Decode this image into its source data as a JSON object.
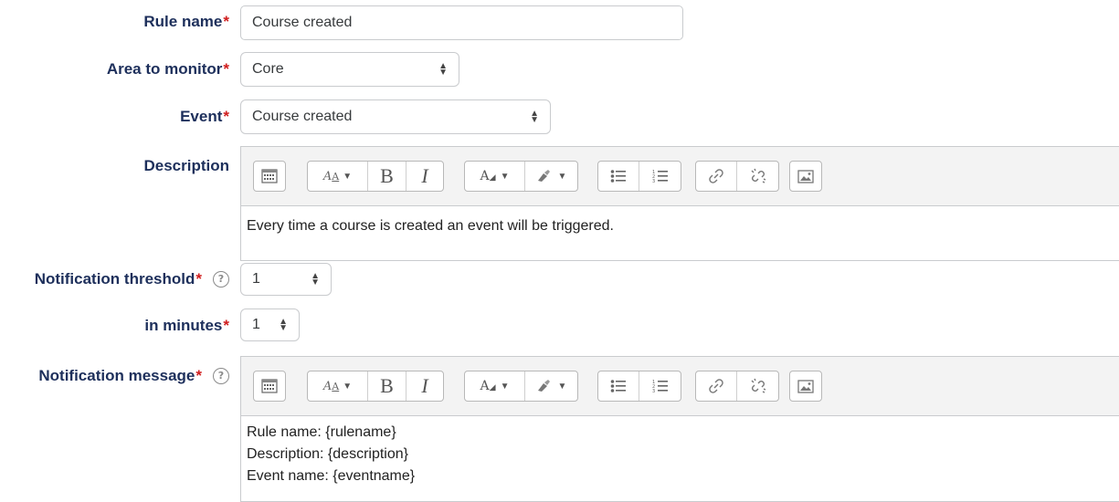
{
  "form": {
    "rule_name": {
      "label": "Rule name",
      "value": "Course created"
    },
    "area": {
      "label": "Area to monitor",
      "value": "Core"
    },
    "event": {
      "label": "Event",
      "value": "Course created"
    },
    "description": {
      "label": "Description",
      "content": "Every time a course is created an event will be triggered."
    },
    "threshold": {
      "label": "Notification threshold",
      "value": "1"
    },
    "minutes": {
      "label": "in minutes",
      "value": "1"
    },
    "message": {
      "label": "Notification message",
      "lines": [
        "Rule name: {rulename}",
        "Description: {description}",
        "Event name: {eventname}"
      ]
    },
    "required_marker": "*",
    "help_glyph": "?"
  },
  "toolbar": {
    "icons": [
      "toggle-toolbar-icon",
      "paragraph-style-icon",
      "bold-icon",
      "italic-icon",
      "text-color-icon",
      "highlight-icon",
      "bullet-list-icon",
      "numbered-list-icon",
      "link-icon",
      "unlink-icon",
      "image-icon"
    ],
    "bold_glyph": "B",
    "italic_glyph": "I"
  },
  "colors": {
    "label": "#1d2f5b",
    "required": "#d01d1d",
    "border": "#c9cbce",
    "toolbar_bg": "#f3f3f3"
  }
}
